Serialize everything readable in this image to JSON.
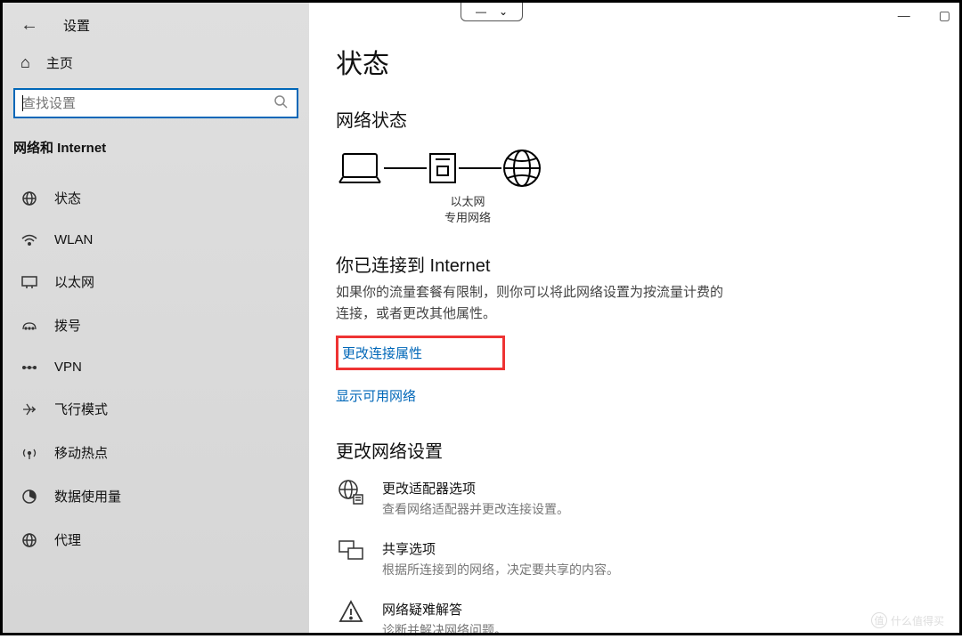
{
  "sidebar": {
    "back": "←",
    "title": "设置",
    "home": "主页",
    "search_placeholder": "查找设置",
    "section": "网络和 Internet",
    "items": [
      {
        "icon": "🌐",
        "label": "状态"
      },
      {
        "icon": "wifi",
        "label": "WLAN"
      },
      {
        "icon": "🖵",
        "label": "以太网"
      },
      {
        "icon": "dial",
        "label": "拨号"
      },
      {
        "icon": "vpn",
        "label": "VPN"
      },
      {
        "icon": "✈",
        "label": "飞行模式"
      },
      {
        "icon": "hotspot",
        "label": "移动热点"
      },
      {
        "icon": "data",
        "label": "数据使用量"
      },
      {
        "icon": "🌐",
        "label": "代理"
      }
    ]
  },
  "main": {
    "title": "状态",
    "subtitle": "网络状态",
    "diagram": {
      "center_line1": "以太网",
      "center_line2": "专用网络"
    },
    "connected_heading": "你已连接到 Internet",
    "connected_body": "如果你的流量套餐有限制，则你可以将此网络设置为按流量计费的连接，或者更改其他属性。",
    "link_change_props": "更改连接属性",
    "link_show_networks": "显示可用网络",
    "change_heading": "更改网络设置",
    "settings": [
      {
        "title": "更改适配器选项",
        "desc": "查看网络适配器并更改连接设置。"
      },
      {
        "title": "共享选项",
        "desc": "根据所连接到的网络，决定要共享的内容。"
      },
      {
        "title": "网络疑难解答",
        "desc": "诊断并解决网络问题。"
      }
    ]
  },
  "watermark": "什么值得买"
}
